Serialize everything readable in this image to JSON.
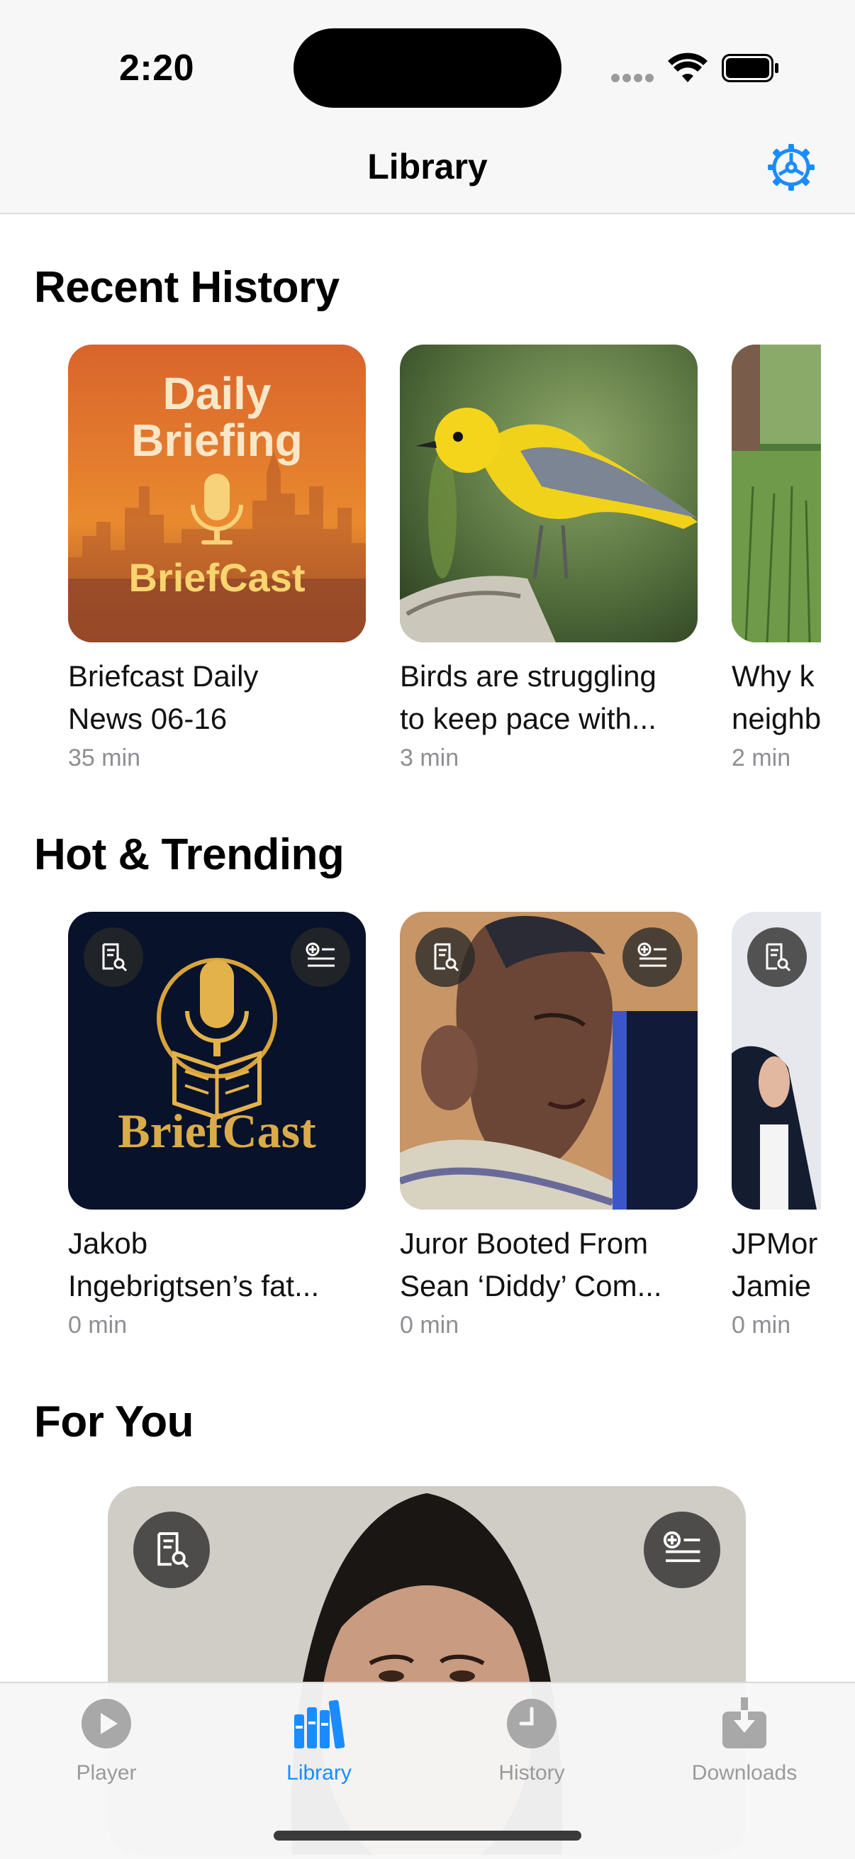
{
  "status_bar": {
    "time": "2:20"
  },
  "nav": {
    "title": "Library",
    "settings_icon": "gear-icon",
    "accent": "#1a8cff"
  },
  "sections": {
    "recent": {
      "title": "Recent History",
      "items": [
        {
          "art_line1": "Daily",
          "art_line2": "Briefing",
          "art_brand": "BriefCast",
          "title_line1": "Briefcast Daily",
          "title_line2": "News 06-16",
          "duration": "35 min"
        },
        {
          "title_line1": "Birds are struggling",
          "title_line2": "to keep pace with...",
          "duration": "3 min"
        },
        {
          "title_line1": "Why k",
          "title_line2": "neighb",
          "duration": "2 min"
        }
      ]
    },
    "trending": {
      "title": "Hot & Trending",
      "items": [
        {
          "art_brand": "BriefCast",
          "title_line1": "Jakob",
          "title_line2": "Ingebrigtsen’s fat...",
          "duration": "0 min"
        },
        {
          "title_line1": "Juror Booted From",
          "title_line2": "Sean ‘Diddy’ Com...",
          "duration": "0 min"
        },
        {
          "title_line1": "JPMor",
          "title_line2": "Jamie",
          "duration": "0 min"
        }
      ]
    },
    "for_you": {
      "title": "For You"
    }
  },
  "tabs": [
    {
      "label": "Player",
      "icon": "play-icon",
      "active": false
    },
    {
      "label": "Library",
      "icon": "books-icon",
      "active": true
    },
    {
      "label": "History",
      "icon": "clock-icon",
      "active": false
    },
    {
      "label": "Downloads",
      "icon": "download-icon",
      "active": false
    }
  ]
}
